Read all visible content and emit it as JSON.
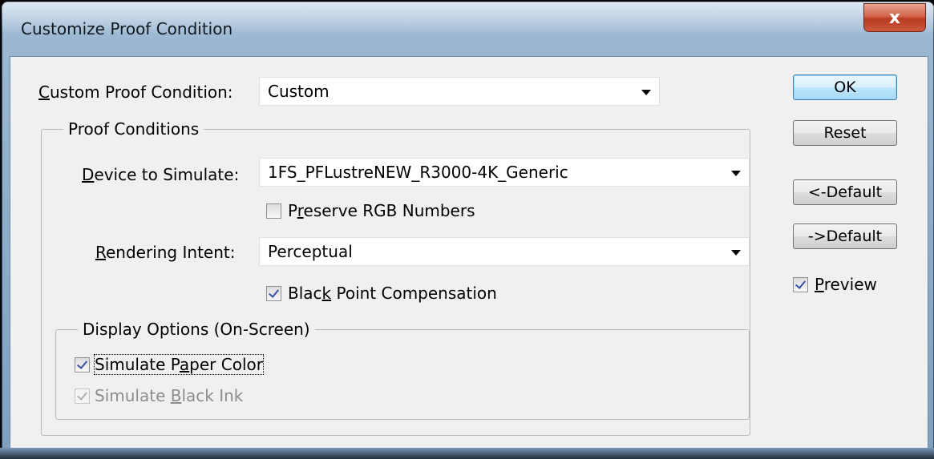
{
  "window": {
    "title": "Customize Proof Condition",
    "close_label": "x"
  },
  "custom_condition": {
    "label_accel": "C",
    "label_rest": "ustom Proof Condition:",
    "value": "Custom"
  },
  "proof_conditions": {
    "legend": "Proof Conditions",
    "device": {
      "label_accel": "D",
      "label_rest": "evice to Simulate:",
      "value": "1FS_PFLustreNEW_R3000-4K_Generic"
    },
    "preserve_rgb": {
      "label_pre": "P",
      "label_accel": "r",
      "label_rest": "eserve RGB Numbers",
      "checked": false
    },
    "intent": {
      "label_accel": "R",
      "label_rest": "endering Intent:",
      "value": "Perceptual"
    },
    "bpc": {
      "label_pre": "Blac",
      "label_accel": "k",
      "label_rest": " Point Compensation",
      "checked": true
    }
  },
  "display_options": {
    "legend": "Display Options (On-Screen)",
    "paper_color": {
      "label_pre": "Simulate P",
      "label_accel": "a",
      "label_rest": "per Color",
      "checked": true
    },
    "black_ink": {
      "label_pre": "Simulate ",
      "label_accel": "B",
      "label_rest": "lack Ink",
      "checked": true,
      "enabled": false
    }
  },
  "buttons": {
    "ok": "OK",
    "reset": "Reset",
    "load_default": "<-Default",
    "save_default": "->Default"
  },
  "preview": {
    "label_accel": "P",
    "label_rest": "review",
    "checked": true
  }
}
